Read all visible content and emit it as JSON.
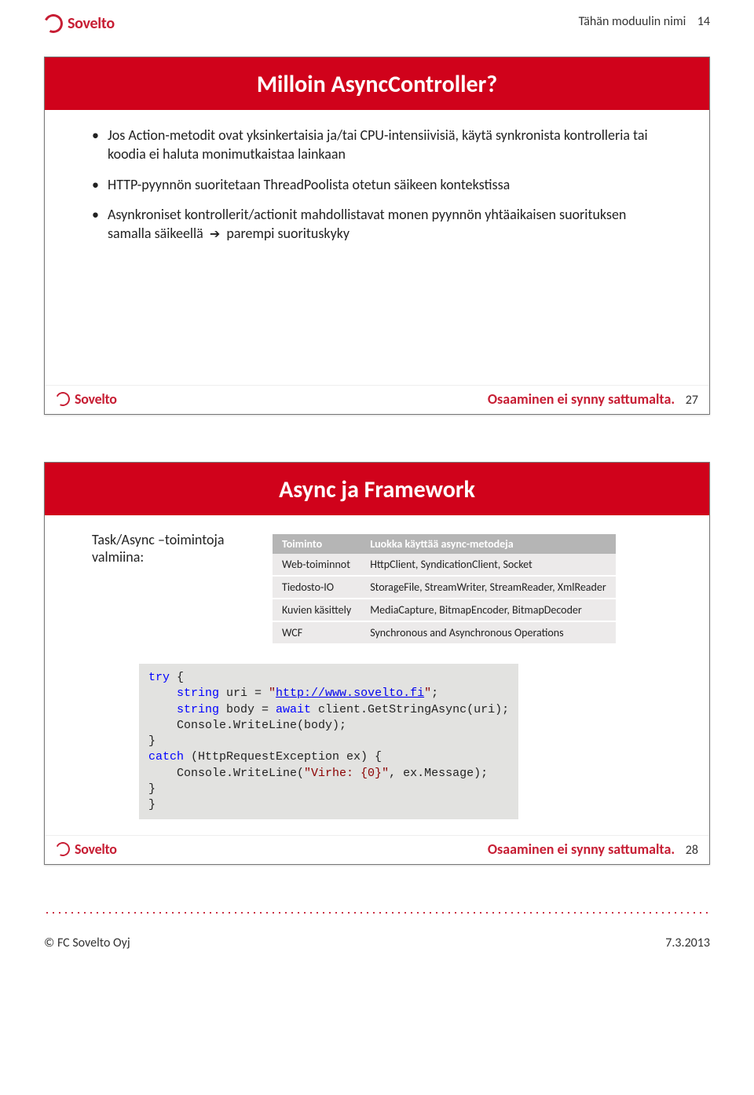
{
  "brand": "Sovelto",
  "tagline": "Osaaminen ei synny sattumalta.",
  "header": {
    "module": "Tähän moduulin nimi",
    "page_num": "14"
  },
  "footer": {
    "copyright": "© FC Sovelto Oyj",
    "date": "7.3.2013"
  },
  "slide1": {
    "title": "Milloin AsyncController?",
    "num": "27",
    "bullets": [
      "Jos Action-metodit ovat yksinkertaisia ja/tai CPU-intensiivisiä, käytä synkronista kontrolleria tai koodia ei haluta monimutkaistaa lainkaan",
      "HTTP-pyynnön suoritetaan ThreadPoolista otetun säikeen kontekstissa"
    ],
    "bullet3_pre": "Asynkroniset kontrollerit/actionit mahdollistavat monen pyynnön yhtäaikaisen suorituksen samalla säikeellä",
    "bullet3_post": "parempi suorituskyky"
  },
  "slide2": {
    "title": "Async ja Framework",
    "num": "28",
    "side_bullet": "Task/Async –toimintoja valmiina:",
    "table": {
      "head": [
        "Toiminto",
        "Luokka käyttää async-metodeja"
      ],
      "rows": [
        [
          "Web-toiminnot",
          "HttpClient, SyndicationClient, Socket"
        ],
        [
          "Tiedosto-IO",
          "StorageFile, StreamWriter, StreamReader, XmlReader"
        ],
        [
          "Kuvien käsittely",
          "MediaCapture, BitmapEncoder, BitmapDecoder"
        ],
        [
          "WCF",
          "Synchronous and Asynchronous Operations"
        ]
      ]
    },
    "code": {
      "l1a": "try",
      "l1b": " {",
      "l2a": "    string",
      "l2b": " uri = ",
      "l2c": "\"",
      "l2link": "http://www.sovelto.fi",
      "l2d": "\"",
      "l2e": ";",
      "l3a": "    string",
      "l3b": " body = ",
      "l3c": "await",
      "l3d": " client.GetStringAsync(uri);",
      "l4": "    Console.WriteLine(body);",
      "l5": "}",
      "l6a": "catch",
      "l6b": " (HttpRequestException ex) {",
      "l7a": "    Console.WriteLine(",
      "l7b": "\"Virhe: {0}\"",
      "l7c": ", ex.Message);",
      "l8": "}",
      "l9": "}"
    }
  }
}
